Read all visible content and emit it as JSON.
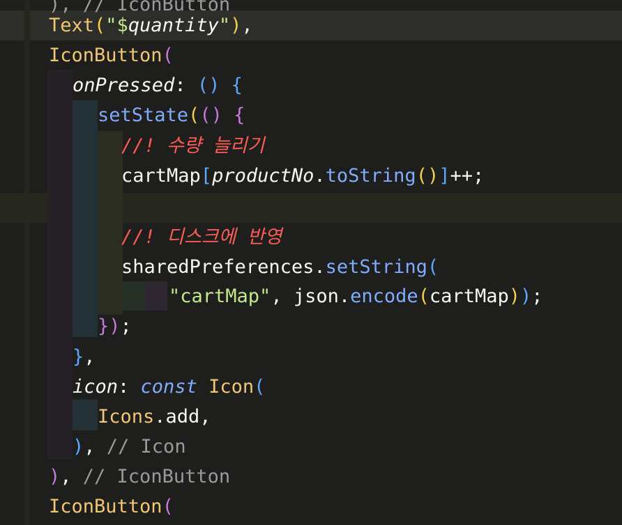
{
  "editor": {
    "colors": {
      "background": "#1e1f1c",
      "type": "#e6db74",
      "string": "#c3e88d",
      "method": "#82aaff",
      "comment": "#9a9a9a",
      "korean_comment": "#ff5c57"
    },
    "lines": [
      {
        "tokens": [
          {
            "t": "), // IconButton",
            "c": "c-comment"
          }
        ]
      },
      {
        "tokens": [
          {
            "t": "Text",
            "c": "c-type2"
          },
          {
            "t": "(",
            "c": "c-paren-y"
          },
          {
            "t": "\"$",
            "c": "c-str"
          },
          {
            "t": "quantity",
            "c": "c-ital"
          },
          {
            "t": "\"",
            "c": "c-str"
          },
          {
            "t": ")",
            "c": "c-paren-y"
          },
          {
            "t": ",",
            "c": "c-plain"
          }
        ]
      },
      {
        "tokens": [
          {
            "t": "IconButton",
            "c": "c-type2"
          },
          {
            "t": "(",
            "c": "c-paren-p"
          }
        ]
      },
      {
        "tokens": [
          {
            "t": "onPressed",
            "c": "c-ital"
          },
          {
            "t": ": ",
            "c": "c-plain"
          },
          {
            "t": "() {",
            "c": "c-paren-b"
          }
        ]
      },
      {
        "tokens": [
          {
            "t": "setState",
            "c": "c-method"
          },
          {
            "t": "(",
            "c": "c-paren-y"
          },
          {
            "t": "() {",
            "c": "c-paren-p"
          }
        ]
      },
      {
        "tokens": [
          {
            "t": "//! 수량 늘리기",
            "c": "c-red"
          }
        ]
      },
      {
        "tokens": [
          {
            "t": "cartMap",
            "c": "c-plain"
          },
          {
            "t": "[",
            "c": "c-paren-b"
          },
          {
            "t": "productNo",
            "c": "c-ital"
          },
          {
            "t": ".",
            "c": "c-plain"
          },
          {
            "t": "toString",
            "c": "c-method"
          },
          {
            "t": "()",
            "c": "c-paren-y"
          },
          {
            "t": "]",
            "c": "c-paren-b"
          },
          {
            "t": "++;",
            "c": "c-plain"
          }
        ]
      },
      {
        "tokens": []
      },
      {
        "tokens": [
          {
            "t": "//! 디스크에 반영",
            "c": "c-red"
          }
        ]
      },
      {
        "tokens": [
          {
            "t": "sharedPreferences",
            "c": "c-plain"
          },
          {
            "t": ".",
            "c": "c-plain"
          },
          {
            "t": "setString",
            "c": "c-method"
          },
          {
            "t": "(",
            "c": "c-paren-b"
          }
        ]
      },
      {
        "tokens": [
          {
            "t": "\"cartMap\"",
            "c": "c-str"
          },
          {
            "t": ", json.",
            "c": "c-plain"
          },
          {
            "t": "encode",
            "c": "c-method"
          },
          {
            "t": "(",
            "c": "c-paren-y"
          },
          {
            "t": "cartMap",
            "c": "c-plain"
          },
          {
            "t": ")",
            "c": "c-paren-y"
          },
          {
            "t": ")",
            "c": "c-paren-b"
          },
          {
            "t": ";",
            "c": "c-plain"
          }
        ]
      },
      {
        "tokens": [
          {
            "t": "})",
            "c": "c-paren-p"
          },
          {
            "t": ";",
            "c": "c-plain"
          }
        ]
      },
      {
        "tokens": [
          {
            "t": "}",
            "c": "c-paren-b"
          },
          {
            "t": ",",
            "c": "c-plain"
          }
        ]
      },
      {
        "tokens": [
          {
            "t": "icon",
            "c": "c-ital"
          },
          {
            "t": ": ",
            "c": "c-plain"
          },
          {
            "t": "const ",
            "c": "c-key"
          },
          {
            "t": "Icon",
            "c": "c-type2"
          },
          {
            "t": "(",
            "c": "c-paren-b"
          }
        ]
      },
      {
        "tokens": [
          {
            "t": "Icons",
            "c": "c-type2"
          },
          {
            "t": ".add,",
            "c": "c-plain"
          }
        ]
      },
      {
        "tokens": [
          {
            "t": ")",
            "c": "c-paren-b"
          },
          {
            "t": ", ",
            "c": "c-plain"
          },
          {
            "t": "// Icon",
            "c": "c-comment"
          }
        ]
      },
      {
        "tokens": [
          {
            "t": ")",
            "c": "c-paren-p"
          },
          {
            "t": ", ",
            "c": "c-plain"
          },
          {
            "t": "// IconButton",
            "c": "c-comment"
          }
        ]
      },
      {
        "tokens": [
          {
            "t": "IconButton",
            "c": "c-type2"
          },
          {
            "t": "(",
            "c": "c-paren-p"
          }
        ]
      }
    ]
  }
}
